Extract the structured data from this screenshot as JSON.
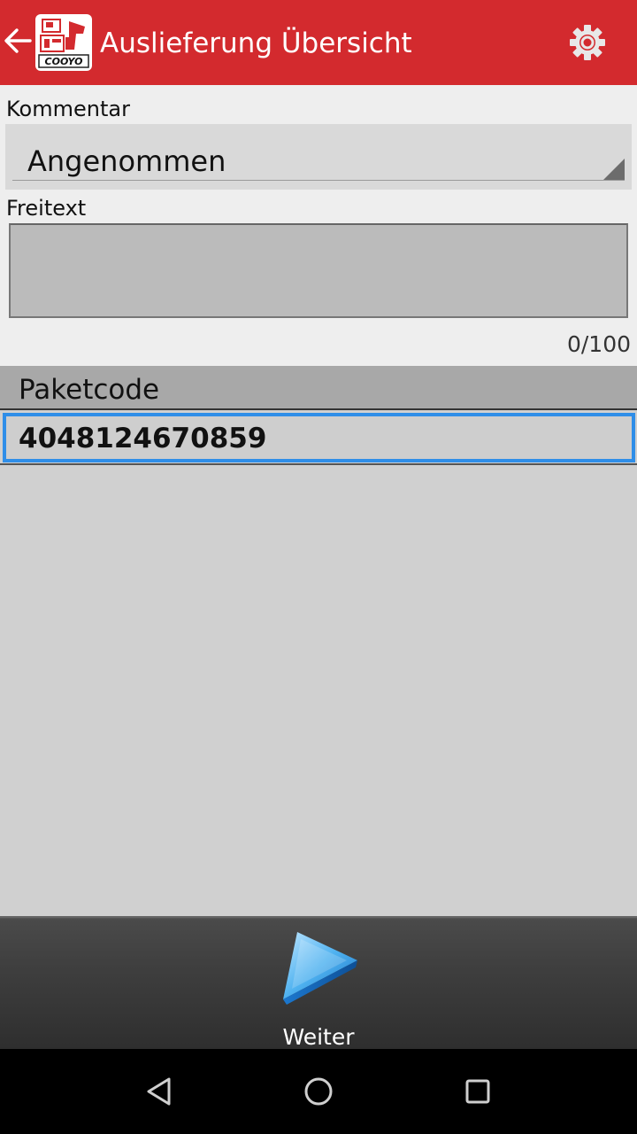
{
  "appbar": {
    "title": "Auslieferung Übersicht",
    "color": "#d32a2e",
    "back_icon": "arrow-left-icon",
    "settings_icon": "gear-icon",
    "logo_text": "COOYO"
  },
  "form": {
    "kommentar_label": "Kommentar",
    "kommentar_value": "Angenommen",
    "freitext_label": "Freitext",
    "freitext_value": "",
    "counter": "0/100"
  },
  "list": {
    "header": "Paketcode",
    "rows": [
      {
        "code": "4048124670859",
        "selected": true
      }
    ],
    "selection_color": "#2f8ee8"
  },
  "bottom": {
    "next_label": "Weiter",
    "next_icon": "play-arrow-icon"
  },
  "navbar": {
    "back_icon": "nav-back-icon",
    "home_icon": "nav-home-icon",
    "recents_icon": "nav-recents-icon"
  }
}
